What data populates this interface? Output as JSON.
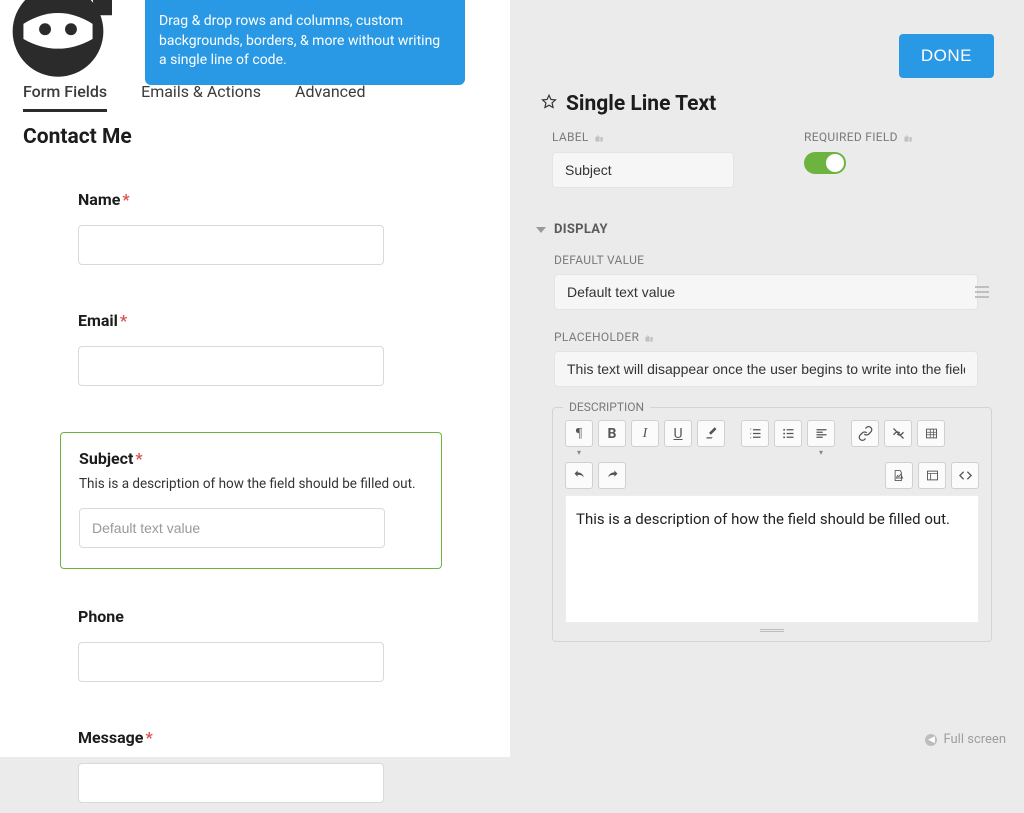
{
  "tooltip": "Drag & drop rows and columns, custom backgrounds, borders, & more without writing a single line of code.",
  "tabs": [
    {
      "label": "Form Fields",
      "active": true
    },
    {
      "label": "Emails & Actions",
      "active": false
    },
    {
      "label": "Advanced",
      "active": false
    }
  ],
  "form": {
    "title": "Contact Me",
    "fields": {
      "name": {
        "label": "Name",
        "required": true
      },
      "email": {
        "label": "Email",
        "required": true
      },
      "subject": {
        "label": "Subject",
        "required": true,
        "description": "This is a description of how the field should be filled out.",
        "placeholder": "Default text value"
      },
      "phone": {
        "label": "Phone",
        "required": false
      },
      "message": {
        "label": "Message",
        "required": true
      }
    }
  },
  "done_button": "DONE",
  "drawer": {
    "title": "Single Line Text",
    "label_setting": {
      "title": "LABEL",
      "value": "Subject"
    },
    "required_setting": {
      "title": "REQUIRED FIELD",
      "value": true
    },
    "display_section": {
      "title": "DISPLAY",
      "default_value": {
        "title": "DEFAULT VALUE",
        "value": "Default text value"
      },
      "placeholder": {
        "title": "PLACEHOLDER",
        "value": "This text will disappear once the user begins to write into the field."
      },
      "description": {
        "title": "DESCRIPTION",
        "value": "This is a description of how the field should be filled out."
      }
    }
  },
  "editor_buttons": {
    "paragraph": "¶",
    "bold": "B",
    "italic": "I",
    "underline": "U"
  },
  "full_screen": "Full screen"
}
